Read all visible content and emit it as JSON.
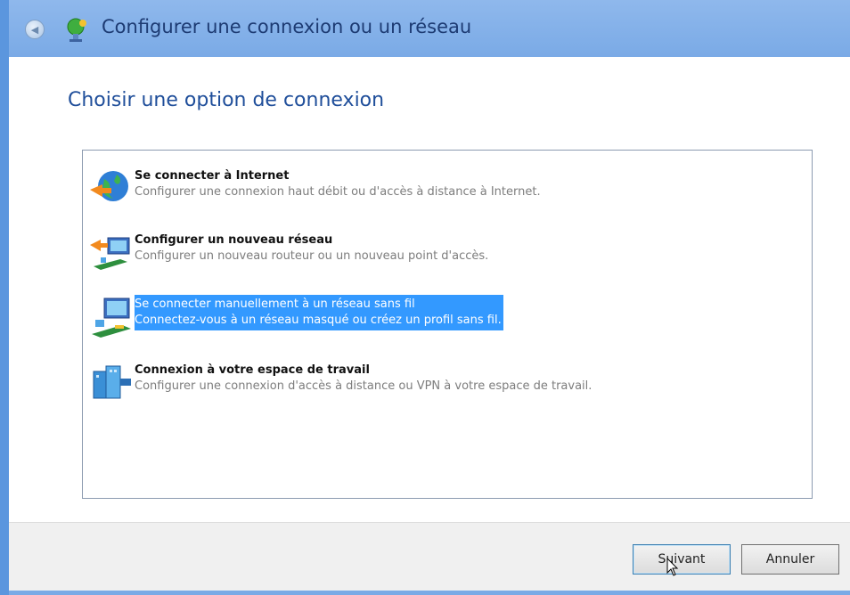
{
  "window": {
    "title": "Configurer une connexion ou un réseau"
  },
  "main": {
    "heading": "Choisir une option de connexion"
  },
  "options": [
    {
      "title": "Se connecter à Internet",
      "description": "Configurer une connexion haut débit ou d'accès à distance à Internet.",
      "icon": "globe-network-icon",
      "selected": false
    },
    {
      "title": "Configurer un nouveau réseau",
      "description": "Configurer un nouveau routeur ou un nouveau point d'accès.",
      "icon": "new-network-icon",
      "selected": false
    },
    {
      "title": "Se connecter manuellement à un réseau sans fil",
      "description": "Connectez-vous à un réseau masqué ou créez un profil sans fil.",
      "icon": "wireless-network-icon",
      "selected": true
    },
    {
      "title": "Connexion à votre espace de travail",
      "description": "Configurer une connexion d'accès à distance ou VPN à votre espace de travail.",
      "icon": "workplace-vpn-icon",
      "selected": false
    }
  ],
  "footer": {
    "next_label": "Suivant",
    "cancel_label": "Annuler"
  },
  "colors": {
    "selection": "#3399ff",
    "title_bar": "#7aaae6",
    "heading": "#1f4e9a"
  }
}
